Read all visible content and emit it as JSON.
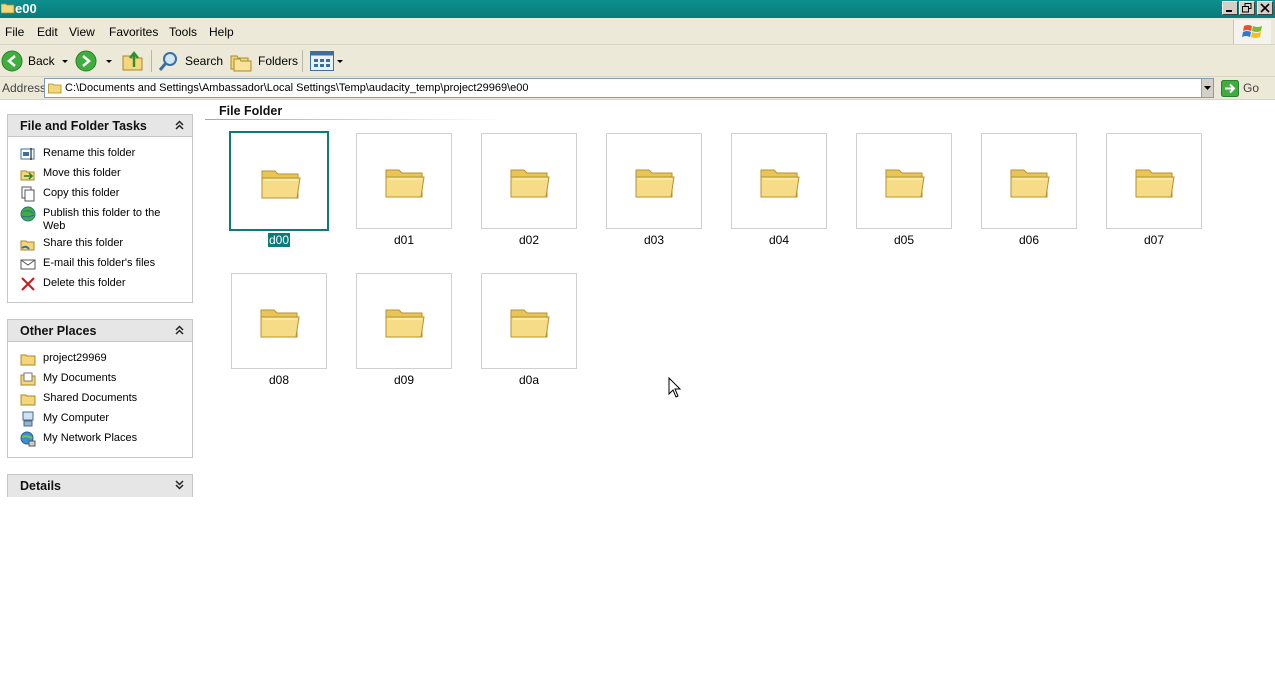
{
  "window": {
    "title": "e00"
  },
  "menu": {
    "items": [
      "File",
      "Edit",
      "View",
      "Favorites",
      "Tools",
      "Help"
    ]
  },
  "toolbar": {
    "back_label": "Back",
    "search_label": "Search",
    "folders_label": "Folders"
  },
  "address": {
    "label": "Address",
    "value": "C:\\Documents and Settings\\Ambassador\\Local Settings\\Temp\\audacity_temp\\project29969\\e00",
    "go_label": "Go"
  },
  "tasks": {
    "title": "File and Folder Tasks",
    "items": [
      {
        "label": "Rename this folder",
        "icon": "rename-icon"
      },
      {
        "label": "Move this folder",
        "icon": "move-icon"
      },
      {
        "label": "Copy this folder",
        "icon": "copy-icon"
      },
      {
        "label": "Publish this folder to the Web",
        "icon": "publish-icon"
      },
      {
        "label": "Share this folder",
        "icon": "share-icon"
      },
      {
        "label": "E-mail this folder's files",
        "icon": "email-icon"
      },
      {
        "label": "Delete this folder",
        "icon": "delete-icon"
      }
    ]
  },
  "other_places": {
    "title": "Other Places",
    "items": [
      {
        "label": "project29969",
        "icon": "folder-icon"
      },
      {
        "label": "My Documents",
        "icon": "my-documents-icon"
      },
      {
        "label": "Shared Documents",
        "icon": "folder-icon"
      },
      {
        "label": "My Computer",
        "icon": "computer-icon"
      },
      {
        "label": "My Network Places",
        "icon": "network-icon"
      }
    ]
  },
  "details": {
    "title": "Details"
  },
  "content": {
    "group_title": "File Folder",
    "folders": [
      {
        "name": "d00",
        "selected": true
      },
      {
        "name": "d01"
      },
      {
        "name": "d02"
      },
      {
        "name": "d03"
      },
      {
        "name": "d04"
      },
      {
        "name": "d05"
      },
      {
        "name": "d06"
      },
      {
        "name": "d07"
      },
      {
        "name": "d08"
      },
      {
        "name": "d09"
      },
      {
        "name": "d0a"
      }
    ]
  },
  "colors": {
    "titlebar": "#0a7a7a",
    "selection": "#0a7a7a",
    "folder": "#f6dc87"
  }
}
